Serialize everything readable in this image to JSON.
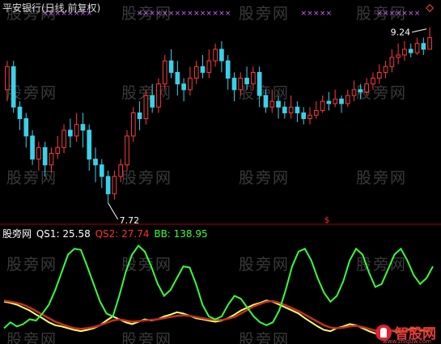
{
  "watermark": "股旁网",
  "header": {
    "title": "平安银行(日线,前复权)"
  },
  "chart_data": [
    {
      "type": "candlestick",
      "title": "平安银行(日线,前复权)",
      "annotations": {
        "high_label": "9.24",
        "low_label": "7.72",
        "dollar_marker": "$"
      },
      "price_range": [
        7.6,
        9.35
      ],
      "candles": [
        [
          8.7,
          8.9,
          8.95,
          8.6
        ],
        [
          8.9,
          8.55,
          8.95,
          8.5
        ],
        [
          8.55,
          8.45,
          8.6,
          8.35
        ],
        [
          8.45,
          8.3,
          8.5,
          8.2
        ],
        [
          8.3,
          8.1,
          8.35,
          8.05
        ],
        [
          8.1,
          8.2,
          8.25,
          8.0
        ],
        [
          8.2,
          8.05,
          8.25,
          7.95
        ],
        [
          8.05,
          8.15,
          8.2,
          7.98
        ],
        [
          8.15,
          8.2,
          8.3,
          8.1
        ],
        [
          8.2,
          8.35,
          8.4,
          8.15
        ],
        [
          8.35,
          8.3,
          8.45,
          8.2
        ],
        [
          8.3,
          8.4,
          8.5,
          8.25
        ],
        [
          8.4,
          8.35,
          8.5,
          8.2
        ],
        [
          8.35,
          8.1,
          8.4,
          8.0
        ],
        [
          8.1,
          8.05,
          8.2,
          7.9
        ],
        [
          8.05,
          7.95,
          8.1,
          7.85
        ],
        [
          7.95,
          7.8,
          8.0,
          7.72
        ],
        [
          7.8,
          7.95,
          8.0,
          7.75
        ],
        [
          7.95,
          8.05,
          8.1,
          7.9
        ],
        [
          8.05,
          8.3,
          8.35,
          8.0
        ],
        [
          8.3,
          8.5,
          8.55,
          8.25
        ],
        [
          8.5,
          8.45,
          8.6,
          8.35
        ],
        [
          8.45,
          8.65,
          8.7,
          8.4
        ],
        [
          8.65,
          8.55,
          8.75,
          8.5
        ],
        [
          8.55,
          8.75,
          8.8,
          8.5
        ],
        [
          8.75,
          8.95,
          9.0,
          8.7
        ],
        [
          8.95,
          8.85,
          9.05,
          8.8
        ],
        [
          8.85,
          8.75,
          8.95,
          8.65
        ],
        [
          8.75,
          8.7,
          8.8,
          8.6
        ],
        [
          8.7,
          8.8,
          8.9,
          8.65
        ],
        [
          8.8,
          8.9,
          8.95,
          8.75
        ],
        [
          8.9,
          8.85,
          9.0,
          8.8
        ],
        [
          8.85,
          8.95,
          9.05,
          8.8
        ],
        [
          8.95,
          9.05,
          9.1,
          8.9
        ],
        [
          9.05,
          8.95,
          9.12,
          8.85
        ],
        [
          8.95,
          8.8,
          9.0,
          8.7
        ],
        [
          8.8,
          8.7,
          8.85,
          8.6
        ],
        [
          8.7,
          8.8,
          8.85,
          8.65
        ],
        [
          8.8,
          8.75,
          8.9,
          8.7
        ],
        [
          8.75,
          8.85,
          8.9,
          8.7
        ],
        [
          8.85,
          8.65,
          8.9,
          8.55
        ],
        [
          8.65,
          8.55,
          8.7,
          8.5
        ],
        [
          8.55,
          8.6,
          8.7,
          8.5
        ],
        [
          8.6,
          8.55,
          8.65,
          8.45
        ],
        [
          8.55,
          8.5,
          8.6,
          8.45
        ],
        [
          8.5,
          8.55,
          8.65,
          8.45
        ],
        [
          8.55,
          8.5,
          8.6,
          8.42
        ],
        [
          8.5,
          8.45,
          8.55,
          8.4
        ],
        [
          8.45,
          8.48,
          8.55,
          8.4
        ],
        [
          8.48,
          8.52,
          8.6,
          8.45
        ],
        [
          8.52,
          8.6,
          8.65,
          8.5
        ],
        [
          8.6,
          8.58,
          8.68,
          8.52
        ],
        [
          8.58,
          8.62,
          8.7,
          8.55
        ],
        [
          8.62,
          8.58,
          8.65,
          8.5
        ],
        [
          8.58,
          8.65,
          8.7,
          8.55
        ],
        [
          8.65,
          8.7,
          8.78,
          8.6
        ],
        [
          8.7,
          8.68,
          8.75,
          8.62
        ],
        [
          8.68,
          8.75,
          8.8,
          8.65
        ],
        [
          8.75,
          8.8,
          8.85,
          8.7
        ],
        [
          8.8,
          8.85,
          8.92,
          8.75
        ],
        [
          8.85,
          8.9,
          8.95,
          8.8
        ],
        [
          8.9,
          8.98,
          9.05,
          8.85
        ],
        [
          8.98,
          9.0,
          9.1,
          8.92
        ],
        [
          9.0,
          9.05,
          9.12,
          8.95
        ],
        [
          9.05,
          9.02,
          9.1,
          8.98
        ],
        [
          9.02,
          9.1,
          9.15,
          9.0
        ],
        [
          9.1,
          9.05,
          9.15,
          9.0
        ],
        [
          9.05,
          9.15,
          9.24,
          9.05
        ]
      ]
    },
    {
      "type": "line",
      "legend": [
        {
          "name": "股旁网",
          "value": "",
          "color": "#ffffff"
        },
        {
          "name": "QS1",
          "value": "25.58",
          "color": "#ffffff"
        },
        {
          "name": "QS2",
          "value": "27.74",
          "color": "#ff3030"
        },
        {
          "name": "BB",
          "value": "138.95",
          "color": "#38ff38"
        }
      ],
      "ylim": [
        -5,
        160
      ],
      "series": [
        {
          "name": "QS1",
          "color": "#ffff66",
          "values": [
            60,
            58,
            55,
            50,
            45,
            38,
            32,
            25,
            20,
            18,
            15,
            12,
            10,
            12,
            15,
            20,
            28,
            35,
            30,
            25,
            22,
            26,
            30,
            28,
            30,
            35,
            38,
            42,
            40,
            36,
            32,
            30,
            28,
            26,
            28,
            32,
            38,
            45,
            50,
            55,
            58,
            62,
            60,
            55,
            50,
            45,
            40,
            32,
            25,
            18,
            12,
            10,
            15,
            18,
            22,
            20,
            15,
            10,
            6,
            8,
            12,
            10,
            8,
            12,
            15,
            12,
            10,
            15
          ]
        },
        {
          "name": "QS2",
          "color": "#c03020",
          "values": [
            62,
            60,
            58,
            55,
            50,
            44,
            38,
            32,
            26,
            22,
            18,
            15,
            14,
            15,
            17,
            20,
            24,
            28,
            30,
            28,
            26,
            27,
            28,
            29,
            30,
            32,
            34,
            36,
            37,
            36,
            34,
            32,
            30,
            29,
            29,
            31,
            34,
            40,
            46,
            52,
            56,
            60,
            61,
            58,
            54,
            49,
            44,
            38,
            32,
            26,
            20,
            16,
            15,
            16,
            18,
            19,
            17,
            14,
            11,
            10,
            11,
            11,
            10,
            11,
            13,
            13,
            12,
            13
          ]
        },
        {
          "name": "BB",
          "color": "#38ff38",
          "values": [
            15,
            25,
            18,
            22,
            30,
            28,
            40,
            55,
            80,
            110,
            140,
            150,
            148,
            120,
            90,
            60,
            40,
            35,
            70,
            110,
            140,
            155,
            145,
            120,
            90,
            70,
            80,
            100,
            120,
            118,
            90,
            55,
            35,
            30,
            35,
            55,
            70,
            65,
            50,
            35,
            25,
            20,
            25,
            45,
            80,
            120,
            145,
            150,
            130,
            100,
            75,
            60,
            70,
            95,
            130,
            150,
            140,
            110,
            85,
            90,
            115,
            140,
            150,
            130,
            105,
            90,
            100,
            120
          ]
        }
      ]
    }
  ]
}
